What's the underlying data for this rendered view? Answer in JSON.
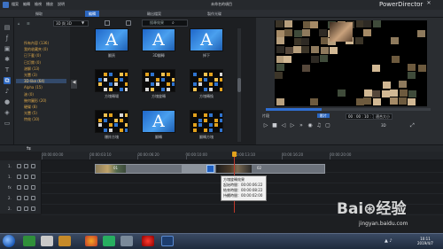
{
  "window": {
    "doc_title": "未命名的項目",
    "brand": "PowerDirector",
    "menu": [
      "檔案",
      "編輯",
      "檢視",
      "播放",
      "說明"
    ],
    "minimize": "—",
    "close": "✕"
  },
  "mode_tabs": {
    "capture": "擷取",
    "edit": "編輯",
    "produce": "輸出檔案",
    "disc": "製作光碟"
  },
  "rooms": [
    "folder-icon",
    "fx-icon",
    "image-icon",
    "title-icon",
    "transition-icon",
    "audio-icon",
    "chapter-icon",
    "subtitle-icon"
  ],
  "categories": {
    "items": [
      "所有內容 (136)",
      "我的收藏夾 (0)",
      "已下載 (0)",
      "已訂閱 (0)",
      "溶解 (13)",
      "光暈 (3)",
      "3D-like (64)",
      "Alpha (15)",
      "溶 (0)",
      "幾何圖形 (20)",
      "硬碟 (8)",
      "光暈 (5)",
      "特效 (10)"
    ],
    "selected_index": 6
  },
  "library": {
    "filter_value": "3D 與 3D",
    "search_placeholder": "搜尋效果",
    "thumbs": [
      {
        "label": "翻頁"
      },
      {
        "label": "3D翻轉"
      },
      {
        "label": "掉下"
      },
      {
        "label": "方塊轉場"
      },
      {
        "label": "方塊旋轉"
      },
      {
        "label": "方塊轉換"
      },
      {
        "label": "爆炸方塊"
      },
      {
        "label": "翻轉"
      },
      {
        "label": "翻轉方塊"
      }
    ]
  },
  "preview": {
    "mode_clip": "片段",
    "mode_movie": "影片",
    "timecode": "00 : 00 : 10 : 18",
    "fit": "適合大小",
    "three_d": "3D",
    "progress": 0.34
  },
  "timeline": {
    "ticks": [
      "00:00:00:00",
      "00:00:03:10",
      "00:00:06:20",
      "00:00:10:00",
      "00:00:13:10",
      "00:00:16:20",
      "00:00:20:00"
    ],
    "tracks": [
      {
        "label": "1."
      },
      {
        "label": "1."
      },
      {
        "label": "fx"
      },
      {
        "label": "2."
      },
      {
        "label": "2."
      }
    ],
    "clip_1_label": "01",
    "clip_2_label": "02"
  },
  "tooltip": {
    "title": "方塊旋轉效果",
    "start": "起始時間：00:00:06:22",
    "end": "結束時間：00:00:08:22",
    "duration": "持續時間：00:00:02:00"
  },
  "taskbar": {
    "time": "10:11",
    "date": "2019/4/7",
    "tray": "▲ ♪"
  },
  "watermark": {
    "logo": "Bai⊛经验",
    "url": "jingyan.baidu.com"
  }
}
